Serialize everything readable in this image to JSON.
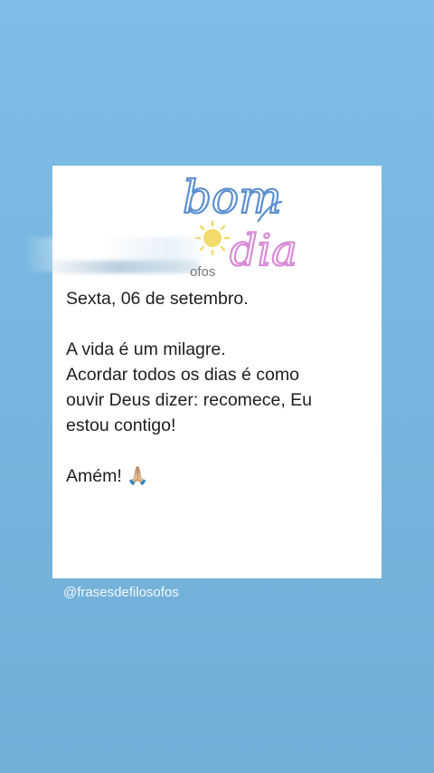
{
  "sticker": {
    "line1": "bom",
    "line2": "dia"
  },
  "post": {
    "username_partial": "ofos",
    "date": "Sexta, 06 de setembro.",
    "line1": "A vida é um milagre.",
    "line2": "Acordar todos os dias é como",
    "line3": "ouvir Deus dizer: recomece, Eu",
    "line4": "estou contigo!",
    "closing": "Amém! 🙏🏼"
  },
  "story": {
    "handle": "@frasesdefilosofos"
  },
  "colors": {
    "background": "#7dbde6",
    "sticker_blue": "#5b8fd0",
    "sticker_pink": "#d98ad8",
    "sun": "#f3dc6b"
  }
}
